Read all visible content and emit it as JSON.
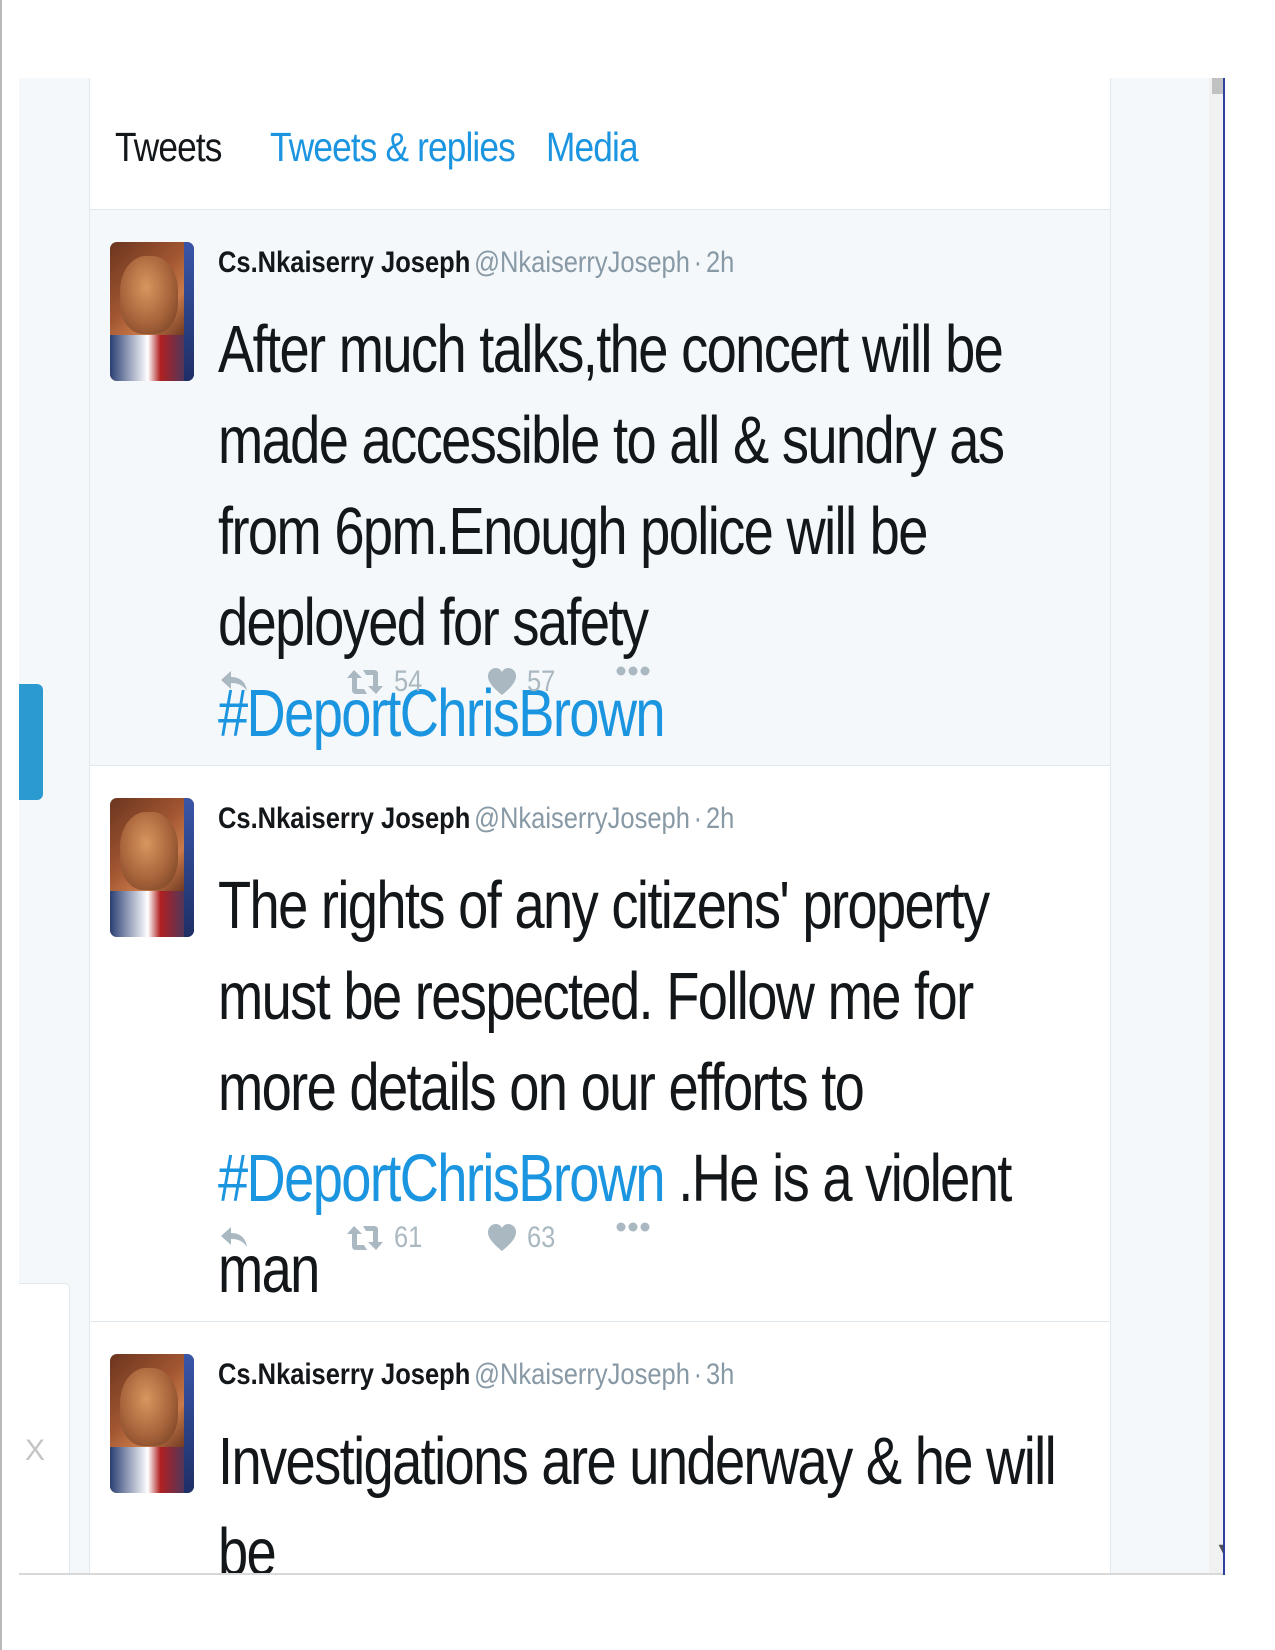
{
  "tabs": {
    "tweets": "Tweets",
    "tweets_replies": "Tweets & replies",
    "media": "Media"
  },
  "tweets": [
    {
      "display_name": "Cs.Nkaiserry Joseph",
      "username": "@NkaiserryJoseph",
      "separator": "·",
      "time": "2h",
      "text_before": "After much talks,the concert will be made accessible to all & sundry as from 6pm.Enough police will be deployed for safety ",
      "hashtag": "#DeportChrisBrown",
      "text_after": "",
      "retweets": "54",
      "likes": "57"
    },
    {
      "display_name": "Cs.Nkaiserry Joseph",
      "username": "@NkaiserryJoseph",
      "separator": "·",
      "time": "2h",
      "text_before": "The rights of any citizens' property must be respected. Follow me for more details on our efforts to ",
      "hashtag": "#DeportChrisBrown",
      "text_after": " .He is a violent man",
      "retweets": "61",
      "likes": "63"
    },
    {
      "display_name": "Cs.Nkaiserry Joseph",
      "username": "@NkaiserryJoseph",
      "separator": "·",
      "time": "3h",
      "text_before": "Investigations are underway & he will be",
      "hashtag": "",
      "text_after": ""
    }
  ],
  "sidebar": {
    "close_glyph": "X"
  },
  "icons": {
    "reply": "reply-icon",
    "retweet": "retweet-icon",
    "like": "heart-icon",
    "more": "more-dots-icon",
    "scroll_down": "scroll-down-arrow-icon"
  },
  "colors": {
    "accent": "#1b95e0",
    "text": "#14171a",
    "muted": "#8899a6",
    "icon": "#aab8c2",
    "highlight_bg": "#f5f8fa"
  }
}
